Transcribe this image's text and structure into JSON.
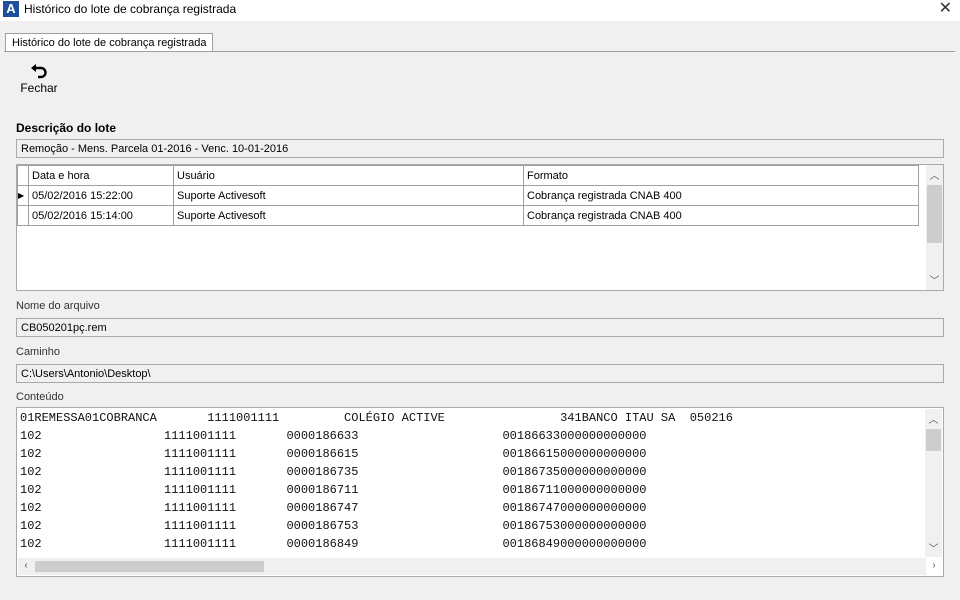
{
  "window": {
    "title": "Histórico do lote de cobrança registrada",
    "app_icon_letter": "A",
    "close_glyph": "✕"
  },
  "tab": {
    "label": "Histórico do lote de cobrança registrada"
  },
  "toolbar": {
    "close_label": "Fechar",
    "close_icon": "undo-arrow-icon"
  },
  "description": {
    "label": "Descrição do lote",
    "value": "Remoção - Mens. Parcela 01-2016 - Venc. 10-01-2016"
  },
  "history_table": {
    "columns": [
      "Data e hora",
      "Usuário",
      "Formato"
    ],
    "rows": [
      {
        "datetime": "05/02/2016 15:22:00",
        "user": "Suporte Activesoft",
        "format": "Cobrança registrada CNAB 400",
        "current": true
      },
      {
        "datetime": "05/02/2016 15:14:00",
        "user": "Suporte Activesoft",
        "format": "Cobrança registrada CNAB 400",
        "current": false
      }
    ]
  },
  "file_name": {
    "label": "Nome do arquivo",
    "value": "CB050201pç.rem"
  },
  "path": {
    "label": "Caminho",
    "value": "C:\\Users\\Antonio\\Desktop\\"
  },
  "content": {
    "label": "Conteúdo",
    "lines": [
      "01REMESSA01COBRANCA       1111001111         COLÉGIO ACTIVE                341BANCO ITAU SA  050216",
      "102                 1111001111       0000186633                    00186633000000000000",
      "102                 1111001111       0000186615                    00186615000000000000",
      "102                 1111001111       0000186735                    00186735000000000000",
      "102                 1111001111       0000186711                    00186711000000000000",
      "102                 1111001111       0000186747                    00186747000000000000",
      "102                 1111001111       0000186753                    00186753000000000000",
      "102                 1111001111       0000186849                    00186849000000000000"
    ]
  },
  "colors": {
    "window_bg": "#f0f0f0",
    "app_icon_bg": "#1f4e9c",
    "border": "#a9a9a9"
  }
}
